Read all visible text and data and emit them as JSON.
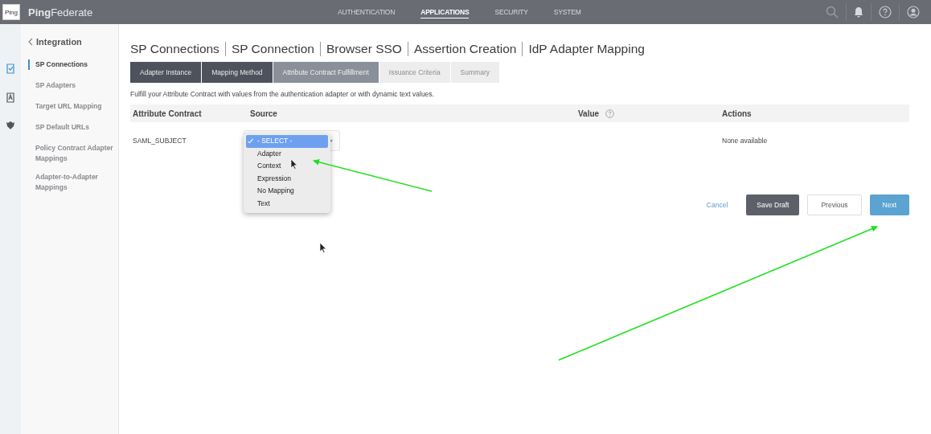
{
  "app": {
    "logo": "Ping",
    "brand_bold": "Ping",
    "brand_rest": "Federate"
  },
  "nav": [
    {
      "label": "AUTHENTICATION",
      "selected": false
    },
    {
      "label": "APPLICATIONS",
      "selected": true
    },
    {
      "label": "SECURITY",
      "selected": false
    },
    {
      "label": "SYSTEM",
      "selected": false
    }
  ],
  "sidebar": {
    "back": "Integration",
    "items": [
      {
        "label": "SP Connections",
        "selected": true
      },
      {
        "label": "SP Adapters",
        "selected": false
      },
      {
        "label": "Target URL Mapping",
        "selected": false
      },
      {
        "label": "SP Default URLs",
        "selected": false
      },
      {
        "label": "Policy Contract Adapter Mappings",
        "selected": false
      },
      {
        "label": "Adapter-to-Adapter Mappings",
        "selected": false
      }
    ]
  },
  "breadcrumb": [
    "SP Connections",
    "SP Connection",
    "Browser SSO",
    "Assertion Creation",
    "IdP Adapter Mapping"
  ],
  "steps": [
    {
      "label": "Adapter Instance",
      "selected": false,
      "disabled": false
    },
    {
      "label": "Mapping Method",
      "selected": false,
      "disabled": false
    },
    {
      "label": "Attribute Contract Fulfillment",
      "selected": true,
      "disabled": false
    },
    {
      "label": "Issuance Criteria",
      "selected": false,
      "disabled": true
    },
    {
      "label": "Summary",
      "selected": false,
      "disabled": true
    }
  ],
  "description": "Fulfill your Attribute Contract with values from the authentication adapter or with dynamic text values.",
  "table": {
    "columns": [
      {
        "label": "Attribute Contract",
        "kind": "plain"
      },
      {
        "label": "Source",
        "kind": "plain"
      },
      {
        "label": "Value",
        "kind": "help"
      },
      {
        "label": "Actions",
        "kind": "plain"
      }
    ],
    "rows": [
      {
        "attribute": "SAML_SUBJECT",
        "actions": "None available",
        "source_options": [
          {
            "label": "- SELECT -",
            "selected": true
          },
          {
            "label": "Adapter",
            "selected": false
          },
          {
            "label": "Context",
            "selected": false
          },
          {
            "label": "Expression",
            "selected": false
          },
          {
            "label": "No Mapping",
            "selected": false
          },
          {
            "label": "Text",
            "selected": false
          }
        ]
      }
    ]
  },
  "buttons": [
    {
      "label": "Cancel",
      "kind": "link"
    },
    {
      "label": "Save Draft",
      "kind": "dark"
    },
    {
      "label": "Previous",
      "kind": "plain"
    },
    {
      "label": "Next",
      "kind": "primary"
    }
  ]
}
